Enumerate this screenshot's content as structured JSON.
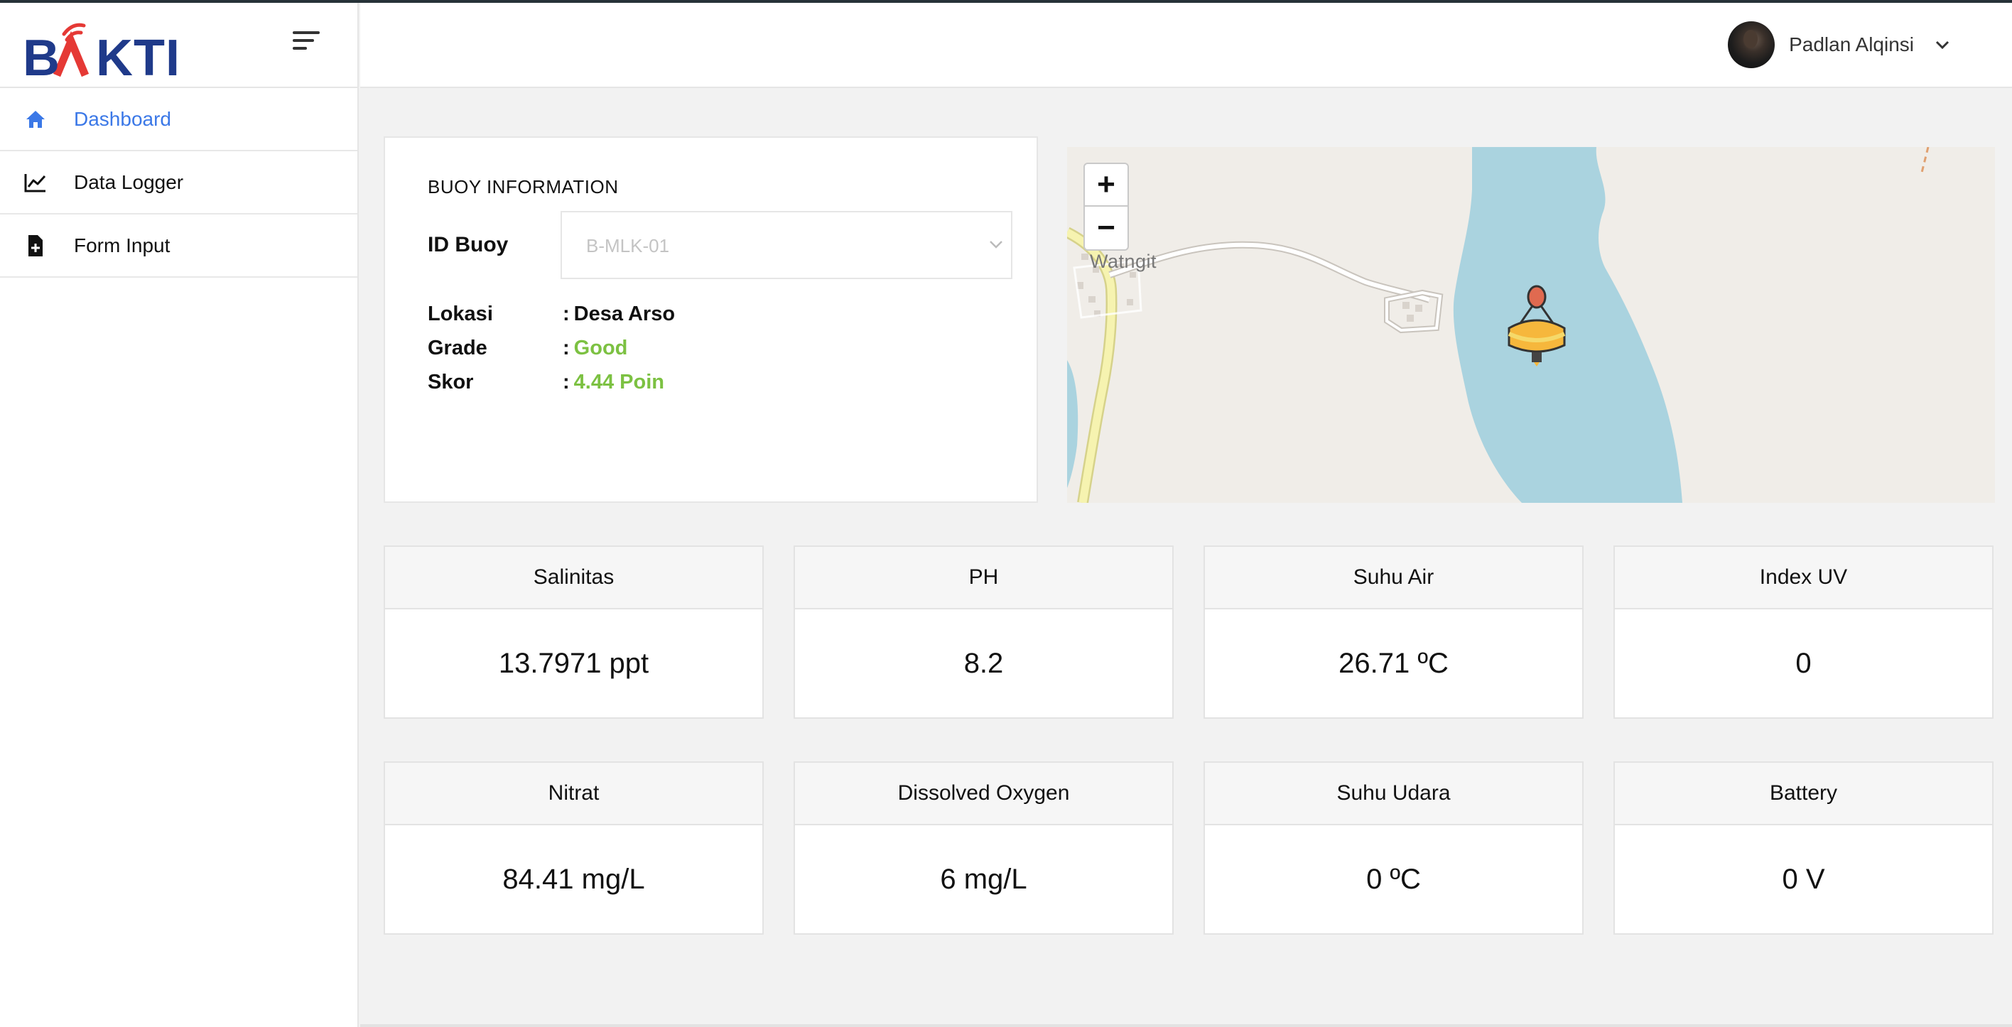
{
  "brand": {
    "logo_text": "BAKTI",
    "logo_icon": "bakti-signal-logo"
  },
  "header": {
    "user_name": "Padlan Alqinsi"
  },
  "sidebar": {
    "items": [
      {
        "label": "Dashboard",
        "icon": "home-icon",
        "active": true
      },
      {
        "label": "Data Logger",
        "icon": "line-chart-icon",
        "active": false
      },
      {
        "label": "Form Input",
        "icon": "file-plus-icon",
        "active": false
      }
    ]
  },
  "buoy_info": {
    "title": "BUOY INFORMATION",
    "id_label": "ID Buoy",
    "id_value": "B-MLK-01",
    "rows": [
      {
        "key": "Lokasi",
        "sep": ":",
        "value": "Desa Arso"
      },
      {
        "key": "Grade",
        "sep": ":",
        "value": "Good"
      },
      {
        "key": "Skor",
        "sep": ":",
        "value": "4.44 Poin"
      }
    ]
  },
  "map": {
    "zoom_in": "+",
    "zoom_out": "−",
    "place_label": "Watngit",
    "marker_icon": "buoy-marker-icon"
  },
  "metrics": [
    {
      "label": "Salinitas",
      "value": "13.7971 ppt"
    },
    {
      "label": "PH",
      "value": "8.2"
    },
    {
      "label": "Suhu Air",
      "value": "26.71 ºC"
    },
    {
      "label": "Index UV",
      "value": "0"
    },
    {
      "label": "Nitrat",
      "value": "84.41 mg/L"
    },
    {
      "label": "Dissolved Oxygen",
      "value": "6 mg/L"
    },
    {
      "label": "Suhu Udara",
      "value": "0 ºC"
    },
    {
      "label": "Battery",
      "value": "0 V"
    }
  ],
  "colors": {
    "accent_blue": "#3b78e7",
    "good_green": "#7cc142",
    "brand_navy": "#1f3a8a",
    "brand_red": "#e53935",
    "water": "#aad3df"
  }
}
